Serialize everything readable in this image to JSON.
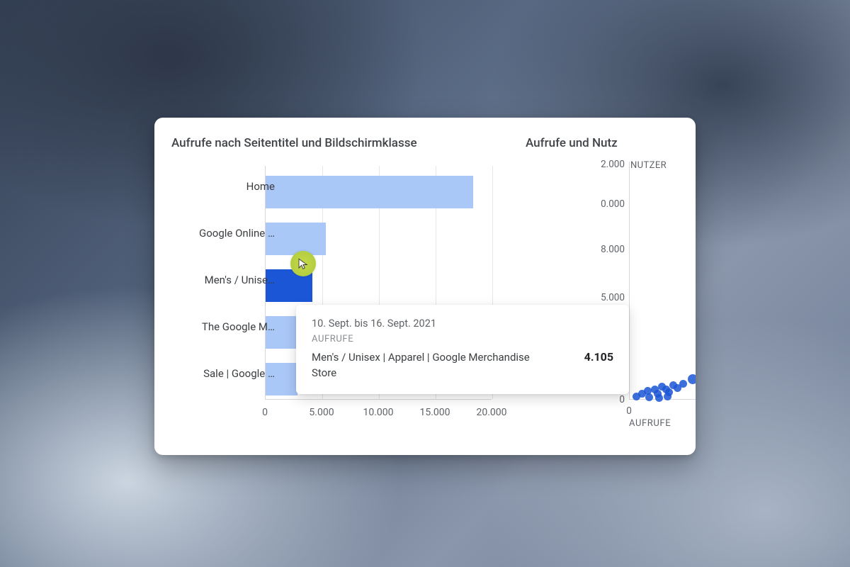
{
  "chart1": {
    "title": "Aufrufe nach Seitentitel und Bildschirmklasse",
    "x_ticks": [
      "0",
      "5.000",
      "10.000",
      "15.000",
      "20.000"
    ],
    "categories_truncated": [
      "Home",
      "Google Online …",
      "Men's / Unise…",
      "The Google M…",
      "Sale | Google …"
    ],
    "highlighted_index": 2
  },
  "chart2": {
    "title": "Aufrufe und Nutz",
    "y_ticks": [
      "2.000",
      "0.000",
      "8.000",
      "5.000",
      "0"
    ],
    "legend_col": "NUTZER",
    "xlabel": "AUFRUFE",
    "x_tick0": "0"
  },
  "tooltip": {
    "date_range": "10. Sept. bis 16. Sept. 2021",
    "metric_label": "AUFRUFE",
    "item_name": "Men's / Unisex | Apparel | Google Merchandise Store",
    "value": "4.105"
  },
  "colors": {
    "bar": "#a9c7f7",
    "bar_highlight": "#1a56d6",
    "dot": "#1a56d6",
    "grid": "#e4e6e9"
  },
  "chart_data": [
    {
      "type": "bar",
      "orientation": "horizontal",
      "title": "Aufrufe nach Seitentitel und Bildschirmklasse",
      "xlabel": "",
      "ylabel": "",
      "xlim": [
        0,
        20000
      ],
      "x_ticks": [
        0,
        5000,
        10000,
        15000,
        20000
      ],
      "categories": [
        "Home",
        "Google Online …",
        "Men's / Unisex | Apparel | Google Merchandise Store",
        "The Google M…",
        "Sale | Google …"
      ],
      "values": [
        18300,
        5300,
        4105,
        3000,
        2800
      ],
      "highlighted_index": 2
    },
    {
      "type": "scatter",
      "title": "Aufrufe und Nutzer",
      "xlabel": "AUFRUFE",
      "ylabel": "NUTZER",
      "note": "Chart is cropped on the right edge; only a cluster of points near the origin and partial y-axis tick labels are visible."
    }
  ]
}
